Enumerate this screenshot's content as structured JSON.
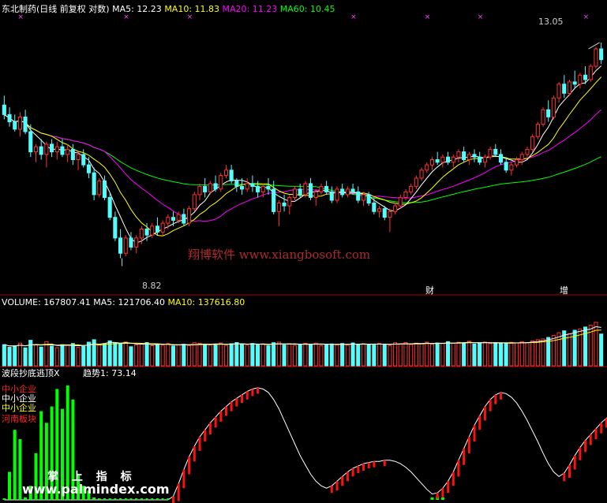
{
  "chart_data": [
    {
      "type": "candlestick",
      "title": "东北制药(日线 前复权 对数)",
      "indicators": [
        {
          "label": "MA5:",
          "value": "12.23",
          "color": "#ffffff"
        },
        {
          "label": "MA10:",
          "value": "11.83",
          "color": "#ffff00"
        },
        {
          "label": "MA20:",
          "value": "11.23",
          "color": "#ff00ff"
        },
        {
          "label": "MA60:",
          "value": "10.45",
          "color": "#00ff00"
        }
      ],
      "ylim": [
        8.3,
        13.7
      ],
      "high_label": "13.05",
      "low_label": "8.82",
      "markers": [
        "财",
        "增"
      ],
      "candles": [
        [
          11.65,
          11.85,
          11.35,
          11.45
        ],
        [
          11.45,
          11.6,
          11.2,
          11.3
        ],
        [
          11.3,
          11.45,
          11.1,
          11.15
        ],
        [
          11.15,
          11.5,
          11.0,
          11.4
        ],
        [
          11.4,
          11.55,
          11.05,
          11.1
        ],
        [
          11.1,
          11.25,
          10.6,
          10.7
        ],
        [
          10.7,
          10.85,
          10.5,
          10.8
        ],
        [
          10.8,
          10.95,
          10.55,
          10.65
        ],
        [
          10.65,
          10.9,
          10.4,
          10.85
        ],
        [
          10.85,
          10.95,
          10.6,
          10.7
        ],
        [
          10.7,
          10.9,
          10.55,
          10.8
        ],
        [
          10.8,
          10.95,
          10.6,
          10.65
        ],
        [
          10.65,
          10.85,
          10.5,
          10.75
        ],
        [
          10.75,
          10.85,
          10.45,
          10.55
        ],
        [
          10.55,
          10.7,
          10.35,
          10.65
        ],
        [
          10.65,
          10.75,
          10.4,
          10.45
        ],
        [
          10.45,
          10.6,
          10.2,
          10.3
        ],
        [
          10.3,
          10.4,
          9.8,
          9.9
        ],
        [
          9.9,
          10.2,
          9.85,
          10.15
        ],
        [
          10.15,
          10.25,
          9.8,
          9.85
        ],
        [
          9.85,
          9.95,
          9.45,
          9.5
        ],
        [
          9.5,
          9.6,
          9.1,
          9.15
        ],
        [
          9.15,
          9.3,
          8.82,
          8.9
        ],
        [
          8.9,
          9.2,
          8.85,
          9.15
        ],
        [
          9.15,
          9.25,
          8.95,
          9.0
        ],
        [
          9.0,
          9.2,
          8.9,
          9.15
        ],
        [
          9.15,
          9.35,
          9.05,
          9.3
        ],
        [
          9.3,
          9.4,
          9.1,
          9.2
        ],
        [
          9.2,
          9.4,
          9.15,
          9.35
        ],
        [
          9.35,
          9.5,
          9.2,
          9.25
        ],
        [
          9.25,
          9.45,
          9.2,
          9.4
        ],
        [
          9.4,
          9.55,
          9.3,
          9.5
        ],
        [
          9.5,
          9.6,
          9.35,
          9.45
        ],
        [
          9.45,
          9.6,
          9.4,
          9.55
        ],
        [
          9.55,
          9.65,
          9.35,
          9.4
        ],
        [
          9.4,
          9.7,
          9.35,
          9.65
        ],
        [
          9.65,
          9.95,
          9.6,
          9.9
        ],
        [
          9.9,
          10.1,
          9.8,
          10.05
        ],
        [
          10.05,
          10.2,
          9.85,
          9.95
        ],
        [
          9.95,
          10.15,
          9.9,
          10.1
        ],
        [
          10.1,
          10.25,
          9.95,
          10.0
        ],
        [
          10.0,
          10.3,
          9.95,
          10.25
        ],
        [
          10.25,
          10.45,
          10.2,
          10.35
        ],
        [
          10.35,
          10.45,
          10.1,
          10.15
        ],
        [
          10.15,
          10.2,
          9.95,
          10.05
        ],
        [
          10.05,
          10.2,
          9.9,
          10.0
        ],
        [
          10.0,
          10.2,
          9.95,
          10.1
        ],
        [
          10.1,
          10.25,
          9.95,
          10.05
        ],
        [
          10.05,
          10.15,
          9.85,
          9.95
        ],
        [
          9.95,
          10.1,
          9.85,
          10.05
        ],
        [
          10.05,
          10.2,
          9.9,
          10.0
        ],
        [
          10.0,
          10.15,
          9.55,
          9.6
        ],
        [
          9.6,
          9.8,
          9.35,
          9.75
        ],
        [
          9.75,
          9.9,
          9.6,
          9.7
        ],
        [
          9.7,
          9.9,
          9.55,
          9.85
        ],
        [
          9.85,
          10.05,
          9.8,
          10.0
        ],
        [
          10.0,
          10.1,
          9.85,
          9.9
        ],
        [
          9.9,
          10.15,
          9.85,
          10.1
        ],
        [
          10.1,
          10.2,
          9.8,
          9.85
        ],
        [
          9.85,
          10.0,
          9.7,
          9.95
        ],
        [
          9.95,
          10.1,
          9.9,
          10.05
        ],
        [
          10.05,
          10.15,
          9.9,
          9.95
        ],
        [
          9.95,
          10.05,
          9.75,
          9.8
        ],
        [
          9.8,
          10.05,
          9.75,
          10.0
        ],
        [
          10.0,
          10.1,
          9.85,
          9.9
        ],
        [
          9.9,
          10.05,
          9.85,
          10.0
        ],
        [
          10.0,
          10.1,
          9.9,
          9.95
        ],
        [
          9.95,
          10.05,
          9.75,
          9.8
        ],
        [
          9.8,
          9.95,
          9.7,
          9.9
        ],
        [
          9.9,
          9.95,
          9.7,
          9.75
        ],
        [
          9.75,
          9.85,
          9.55,
          9.6
        ],
        [
          9.6,
          9.7,
          9.5,
          9.65
        ],
        [
          9.65,
          9.7,
          9.45,
          9.5
        ],
        [
          9.5,
          9.65,
          9.25,
          9.6
        ],
        [
          9.6,
          9.75,
          9.55,
          9.7
        ],
        [
          9.7,
          9.9,
          9.65,
          9.85
        ],
        [
          9.85,
          10.0,
          9.8,
          9.95
        ],
        [
          9.95,
          10.1,
          9.9,
          10.05
        ],
        [
          10.05,
          10.25,
          10.0,
          10.2
        ],
        [
          10.2,
          10.4,
          10.15,
          10.35
        ],
        [
          10.35,
          10.5,
          10.3,
          10.45
        ],
        [
          10.45,
          10.6,
          10.35,
          10.55
        ],
        [
          10.55,
          10.7,
          10.45,
          10.5
        ],
        [
          10.5,
          10.65,
          10.4,
          10.6
        ],
        [
          10.6,
          10.7,
          10.45,
          10.5
        ],
        [
          10.5,
          10.65,
          10.4,
          10.6
        ],
        [
          10.6,
          10.75,
          10.5,
          10.7
        ],
        [
          10.7,
          10.8,
          10.5,
          10.55
        ],
        [
          10.55,
          10.7,
          10.45,
          10.65
        ],
        [
          10.65,
          10.75,
          10.5,
          10.6
        ],
        [
          10.6,
          10.7,
          10.45,
          10.5
        ],
        [
          10.5,
          10.65,
          10.4,
          10.6
        ],
        [
          10.6,
          10.8,
          10.55,
          10.75
        ],
        [
          10.75,
          10.85,
          10.6,
          10.65
        ],
        [
          10.65,
          10.75,
          10.45,
          10.5
        ],
        [
          10.5,
          10.6,
          10.3,
          10.35
        ],
        [
          10.35,
          10.5,
          10.25,
          10.45
        ],
        [
          10.45,
          10.6,
          10.4,
          10.55
        ],
        [
          10.55,
          10.7,
          10.45,
          10.65
        ],
        [
          10.65,
          10.8,
          10.6,
          10.75
        ],
        [
          10.75,
          11.05,
          10.7,
          11.0
        ],
        [
          11.0,
          11.3,
          10.95,
          11.25
        ],
        [
          11.25,
          11.6,
          11.2,
          11.55
        ],
        [
          11.55,
          11.75,
          11.3,
          11.4
        ],
        [
          11.4,
          11.85,
          11.35,
          11.8
        ],
        [
          11.8,
          12.15,
          11.7,
          12.1
        ],
        [
          12.1,
          12.3,
          11.8,
          11.9
        ],
        [
          11.9,
          12.2,
          11.85,
          12.15
        ],
        [
          12.15,
          12.4,
          12.0,
          12.1
        ],
        [
          12.1,
          12.35,
          12.0,
          12.3
        ],
        [
          12.3,
          12.5,
          12.1,
          12.2
        ],
        [
          12.2,
          12.55,
          12.15,
          12.5
        ],
        [
          12.5,
          12.95,
          12.45,
          12.9
        ],
        [
          12.9,
          13.05,
          12.55,
          12.65
        ]
      ]
    },
    {
      "type": "bar",
      "title": "VOLUME:",
      "value": "167807.41",
      "indicators": [
        {
          "label": "MA5:",
          "value": "121706.40",
          "color": "#ffffff"
        },
        {
          "label": "MA10:",
          "value": "137616.80",
          "color": "#ffff00"
        }
      ],
      "ylim": [
        0,
        300000
      ],
      "values": [
        112000,
        98000,
        105000,
        120000,
        95000,
        135000,
        110000,
        99000,
        128000,
        104000,
        96000,
        112000,
        108000,
        118000,
        97000,
        103000,
        125000,
        138000,
        109000,
        116000,
        132000,
        121000,
        119000,
        126000,
        101000,
        110000,
        117000,
        123000,
        106000,
        112000,
        109000,
        118000,
        104000,
        111000,
        114000,
        107000,
        122000,
        119000,
        113000,
        110000,
        115000,
        121000,
        108000,
        117000,
        123000,
        114000,
        109000,
        118000,
        112000,
        116000,
        106000,
        122000,
        125000,
        110000,
        117000,
        108000,
        113000,
        119000,
        112000,
        120000,
        107000,
        114000,
        116000,
        111000,
        118000,
        109000,
        121000,
        114000,
        117000,
        112000,
        110000,
        119000,
        115000,
        108000,
        122000,
        116000,
        123000,
        113000,
        120000,
        118000,
        125000,
        114000,
        121000,
        117000,
        128000,
        119000,
        124000,
        122000,
        130000,
        115000,
        121000,
        126000,
        118000,
        123000,
        119000,
        117000,
        124000,
        121000,
        128000,
        123000,
        132000,
        138000,
        142000,
        150000,
        160000,
        175000,
        185000,
        170000,
        188000,
        195000,
        205000,
        215000,
        230000,
        167807
      ]
    },
    {
      "type": "bar",
      "title": "波段抄底逃顶X",
      "indicators": [
        {
          "label": "趋势1:",
          "value": "73.14",
          "color": "#ffffff"
        }
      ],
      "legend": [
        {
          "label": "中小企业",
          "color": "#ff2020"
        },
        {
          "label": "中小企业",
          "color": "#ffffff"
        },
        {
          "label": "中小企业",
          "color": "#ffff00"
        },
        {
          "label": "河南板块",
          "color": "#ff2020"
        }
      ],
      "ylim": [
        0,
        100
      ],
      "bars": [
        1,
        24,
        60,
        52,
        2,
        12,
        40,
        76,
        66,
        80,
        95,
        78,
        98,
        86,
        22,
        12,
        8,
        2,
        1,
        0,
        0,
        0,
        0,
        0,
        0,
        0,
        0,
        0,
        0,
        0,
        0,
        0,
        0,
        0,
        0,
        0,
        0,
        0,
        0,
        0,
        0,
        0,
        0,
        0,
        0,
        0,
        0,
        0,
        0,
        0,
        0,
        0,
        0,
        0,
        0,
        0,
        0,
        0,
        0,
        0,
        0,
        0,
        0,
        0,
        0,
        0,
        0,
        0,
        0,
        0,
        0,
        0,
        0,
        0,
        0,
        0,
        0,
        0,
        0,
        0,
        0,
        2,
        3,
        2,
        0,
        0,
        0,
        0,
        0,
        0,
        0,
        0,
        0,
        0,
        0,
        0,
        0,
        0,
        0,
        0,
        0,
        0,
        0,
        0,
        0,
        0,
        0,
        0,
        0,
        0,
        0,
        0,
        0,
        0
      ],
      "trend": [
        0,
        0,
        0,
        0,
        0,
        0,
        0,
        0,
        0,
        0,
        0,
        0,
        0,
        0,
        0,
        0,
        0,
        0,
        0,
        0,
        0,
        0,
        0,
        0,
        0,
        0,
        0,
        0,
        0,
        0,
        0,
        0,
        3,
        14,
        26,
        37,
        46,
        54,
        60,
        66,
        71,
        76,
        80,
        84,
        87,
        90,
        93,
        95,
        96,
        95,
        92,
        86,
        78,
        68,
        58,
        48,
        38,
        30,
        22,
        16,
        12,
        10,
        12,
        16,
        20,
        24,
        27,
        29,
        31,
        32,
        33,
        33,
        34,
        34,
        33,
        31,
        28,
        24,
        19,
        14,
        9,
        5,
        6,
        10,
        16,
        24,
        34,
        44,
        54,
        64,
        72,
        80,
        86,
        90,
        92,
        91,
        88,
        83,
        76,
        68,
        59,
        50,
        40,
        31,
        24,
        20,
        23,
        30,
        38,
        45,
        51,
        56,
        61,
        66,
        70,
        73
      ]
    }
  ],
  "watermarks": {
    "brand": "翔博软件 www.xiangbosoft.com",
    "brand2": "掌 上 指 标",
    "site": "www.palmindex.com"
  }
}
